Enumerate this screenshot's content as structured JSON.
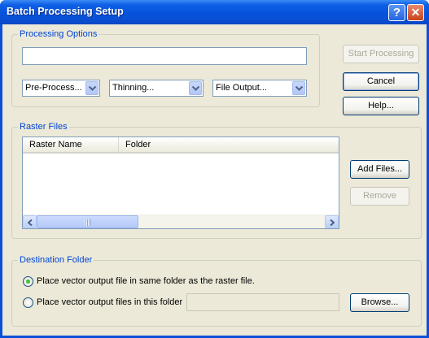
{
  "window": {
    "title": "Batch Processing Setup"
  },
  "titlebar": {
    "help_glyph": "?",
    "close_glyph": "✕"
  },
  "processing_options": {
    "label": "Processing Options",
    "text_value": "",
    "dropdowns": [
      {
        "value": "Pre-Process..."
      },
      {
        "value": "Thinning..."
      },
      {
        "value": "File Output..."
      }
    ]
  },
  "buttons": {
    "start_processing": "Start Processing",
    "cancel": "Cancel",
    "help": "Help...",
    "add_files": "Add Files...",
    "remove": "Remove",
    "browse": "Browse..."
  },
  "raster_files": {
    "label": "Raster Files",
    "columns": [
      "Raster Name",
      "Folder"
    ],
    "rows": []
  },
  "destination": {
    "label": "Destination Folder",
    "options": [
      {
        "label": "Place vector output file in same folder as the raster file.",
        "selected": true
      },
      {
        "label": "Place vector output files in this folder",
        "selected": false
      }
    ],
    "folder_value": ""
  },
  "colors": {
    "titlebar": "#0553dd",
    "group_label": "#0046d5",
    "dialog_bg": "#ece9d8",
    "radio_selected": "#21a121"
  },
  "icons": [
    "help-icon",
    "close-icon",
    "chevron-down-icon",
    "scroll-left-icon",
    "scroll-right-icon"
  ]
}
